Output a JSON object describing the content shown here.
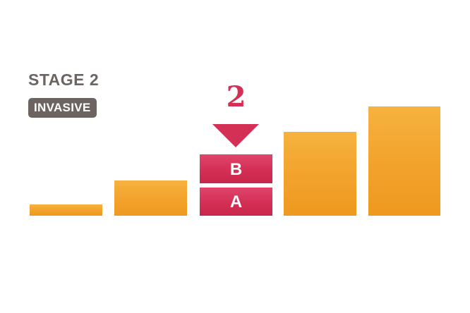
{
  "stage": {
    "title": "STAGE 2",
    "badge": "INVASIVE",
    "number": "2"
  },
  "substages": [
    {
      "label": "B"
    },
    {
      "label": "A"
    }
  ],
  "colors": {
    "steps": "#f2a22b",
    "highlight": "#d42f55",
    "label_gray": "#6b6460"
  },
  "icons": {
    "pointer": "down-arrow-icon"
  }
}
